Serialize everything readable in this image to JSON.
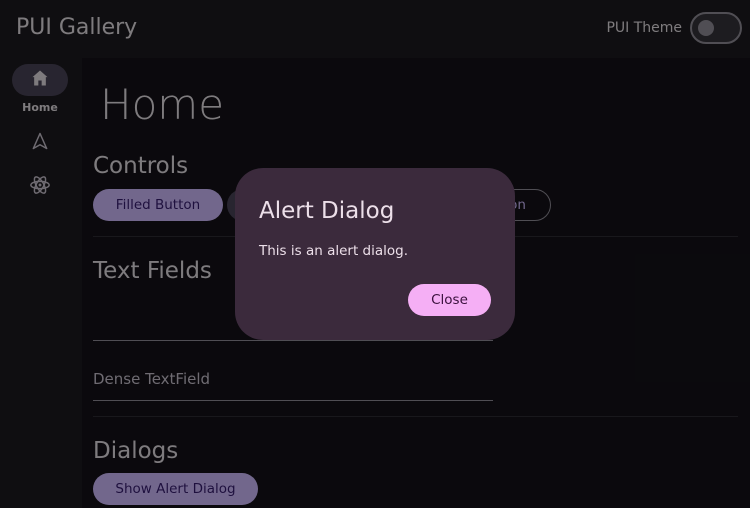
{
  "app": {
    "title": "PUI Gallery"
  },
  "header": {
    "theme_label": "PUI Theme",
    "theme_toggle_on": false
  },
  "nav": {
    "items": [
      {
        "label": "Home",
        "icon": "home-icon",
        "active": true
      },
      {
        "label": "",
        "icon": "navigation-arrow-icon",
        "active": false
      },
      {
        "label": "",
        "icon": "atom-icon",
        "active": false
      }
    ]
  },
  "main": {
    "page_title": "Home",
    "controls": {
      "title": "Controls",
      "filled_button_label": "Filled Button",
      "outlined_button_partial_label": "on"
    },
    "text_fields": {
      "title": "Text Fields",
      "dense_placeholder": "Dense TextField"
    },
    "dialogs": {
      "title": "Dialogs",
      "show_alert_label": "Show Alert Dialog"
    }
  },
  "dialog": {
    "title": "Alert Dialog",
    "body": "This is an alert dialog.",
    "close_label": "Close"
  },
  "colors": {
    "primary": "#d0bcff",
    "dialog_surface": "#3b2a3c",
    "dialog_action": "#f5aff5"
  }
}
